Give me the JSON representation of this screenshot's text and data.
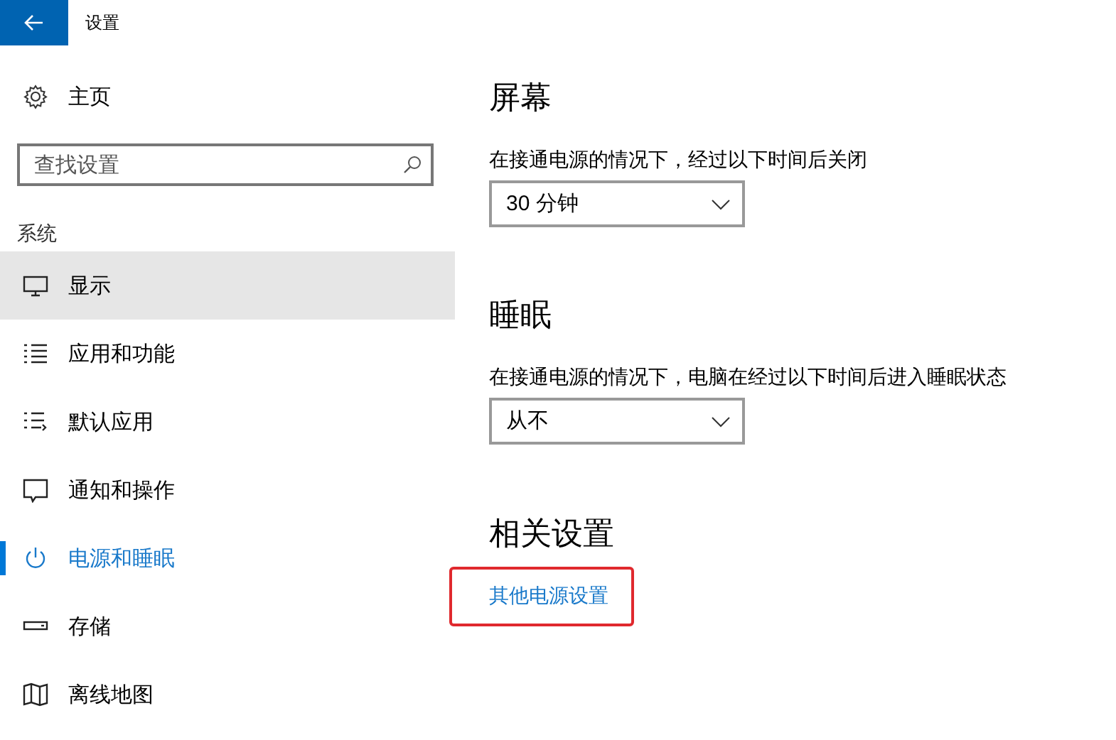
{
  "window": {
    "title": "设置"
  },
  "home": {
    "label": "主页"
  },
  "search": {
    "placeholder": "查找设置"
  },
  "sidebar": {
    "section": "系统",
    "items": [
      {
        "label": "显示",
        "selected": false,
        "hovered": true
      },
      {
        "label": "应用和功能",
        "selected": false,
        "hovered": false
      },
      {
        "label": "默认应用",
        "selected": false,
        "hovered": false
      },
      {
        "label": "通知和操作",
        "selected": false,
        "hovered": false
      },
      {
        "label": "电源和睡眠",
        "selected": true,
        "hovered": false
      },
      {
        "label": "存储",
        "selected": false,
        "hovered": false
      },
      {
        "label": "离线地图",
        "selected": false,
        "hovered": false
      }
    ]
  },
  "sections": [
    {
      "heading": "屏幕",
      "description": "在接通电源的情况下，经过以下时间后关闭",
      "dropdown": "30 分钟"
    },
    {
      "heading": "睡眠",
      "description": "在接通电源的情况下，电脑在经过以下时间后进入睡眠状态",
      "dropdown": "从不"
    }
  ],
  "related": {
    "heading": "相关设置",
    "link": "其他电源设置",
    "highlighted": true
  }
}
